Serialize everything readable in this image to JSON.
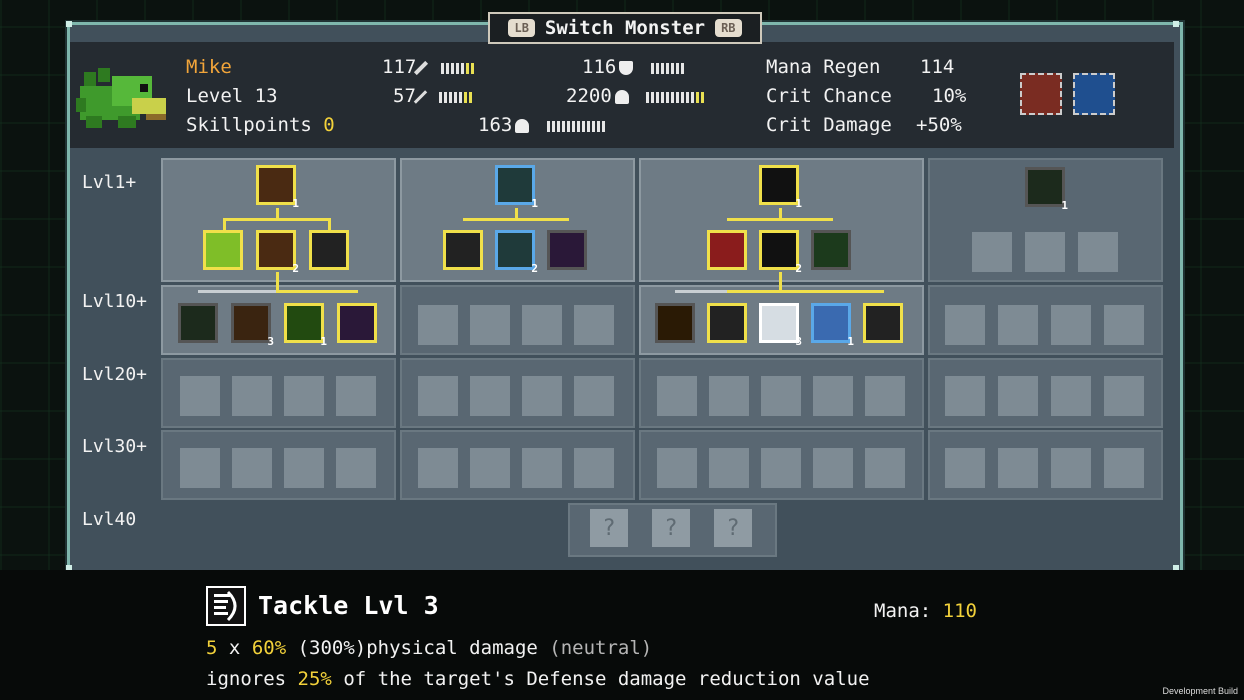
{
  "window": {
    "title": "Switch Monster",
    "lb": "LB",
    "rb": "RB"
  },
  "monster": {
    "name": "Mike",
    "level": "Level 13",
    "skillpoints_label": "Skillpoints",
    "skillpoints_value": "0"
  },
  "stats": {
    "attack": "117",
    "magic": "57",
    "defense": "116",
    "health": "2200",
    "mana": "163",
    "mana_regen_label": "Mana Regen",
    "mana_regen_value": "114",
    "crit_chance_label": "Crit Chance",
    "crit_chance_value": "10%",
    "crit_damage_label": "Crit Damage",
    "crit_damage_value": "+50%"
  },
  "rows": [
    "Lvl1+",
    "Lvl10+",
    "Lvl20+",
    "Lvl30+",
    "Lvl40"
  ],
  "lvl40_placeholders": [
    "?",
    "?",
    "?"
  ],
  "skill": {
    "title": "Tackle Lvl 3",
    "mana_label": "Mana:",
    "mana_value": "110",
    "hits": "5",
    "x": "x",
    "percent": "60%",
    "total": "(300%)",
    "dtype": "physical damage",
    "element": "(neutral)",
    "line2_a": "ignores",
    "line2_pct": "25%",
    "line2_b": "of the target's Defense damage reduction value"
  },
  "footer": {
    "dev": "Development Build"
  },
  "icons": [
    "sword-icon",
    "staff-icon",
    "shield-icon",
    "heart-icon",
    "mana-icon",
    "fire-buff-icon",
    "water-shield-icon",
    "tackle-icon"
  ],
  "colors": {
    "accent": "#f2d13a",
    "name": "#f2a53a",
    "frame": "#7fb7ad"
  }
}
